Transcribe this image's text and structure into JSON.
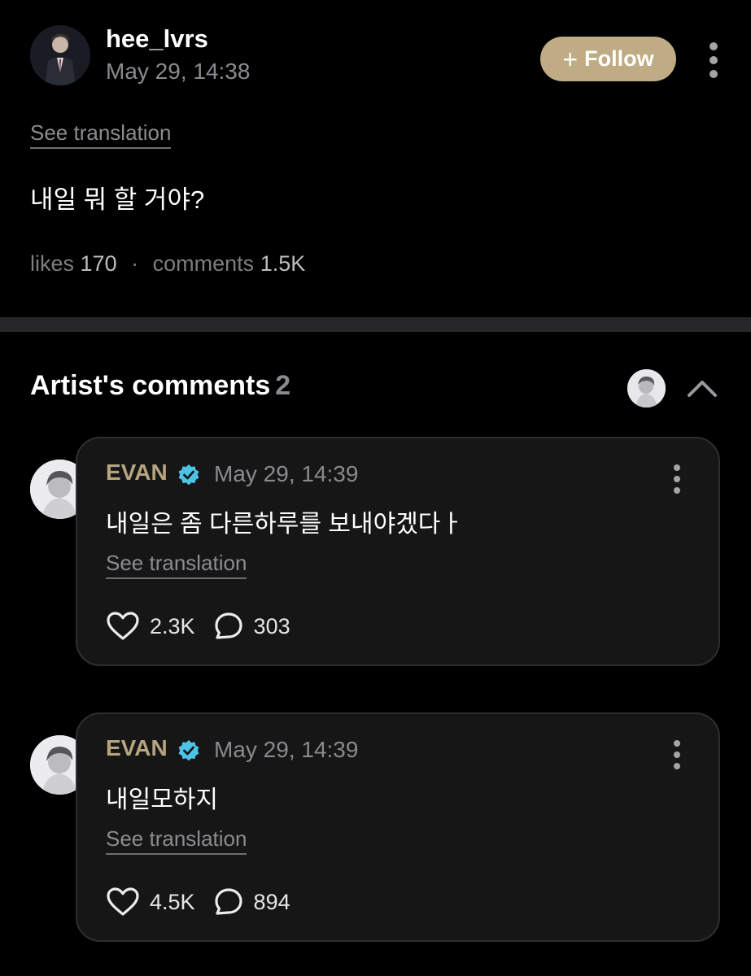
{
  "post": {
    "author": "hee_lvrs",
    "date": "May 29, 14:38",
    "follow_label": "Follow",
    "see_translation": "See translation",
    "text": "내일 뭐 할 거야?",
    "likes_label": "likes",
    "likes_count": "170",
    "comments_label": "comments",
    "comments_count": "1.5K"
  },
  "artist_comments": {
    "title": "Artist's comments",
    "count": "2",
    "comments": [
      {
        "name": "EVAN",
        "date": "May 29, 14:39",
        "text": "내일은 좀 다른하루를 보내야겠다ㅏ",
        "see_translation": "See translation",
        "likes": "2.3K",
        "replies": "303"
      },
      {
        "name": "EVAN",
        "date": "May 29, 14:39",
        "text": "내일모하지",
        "see_translation": "See translation",
        "likes": "4.5K",
        "replies": "894"
      }
    ]
  },
  "colors": {
    "background": "#000000",
    "follow_button": "#bfab84",
    "artist_name": "#b6a57f",
    "verified_badge": "#4ec3e8",
    "card_background": "#161617",
    "muted_text": "#8a8a8e"
  },
  "icons": {
    "follow": "plus-icon",
    "more": "more-vertical-icon",
    "collapse": "chevron-up-icon",
    "verified": "verified-badge-icon",
    "like": "heart-icon",
    "reply": "comment-bubble-icon"
  }
}
